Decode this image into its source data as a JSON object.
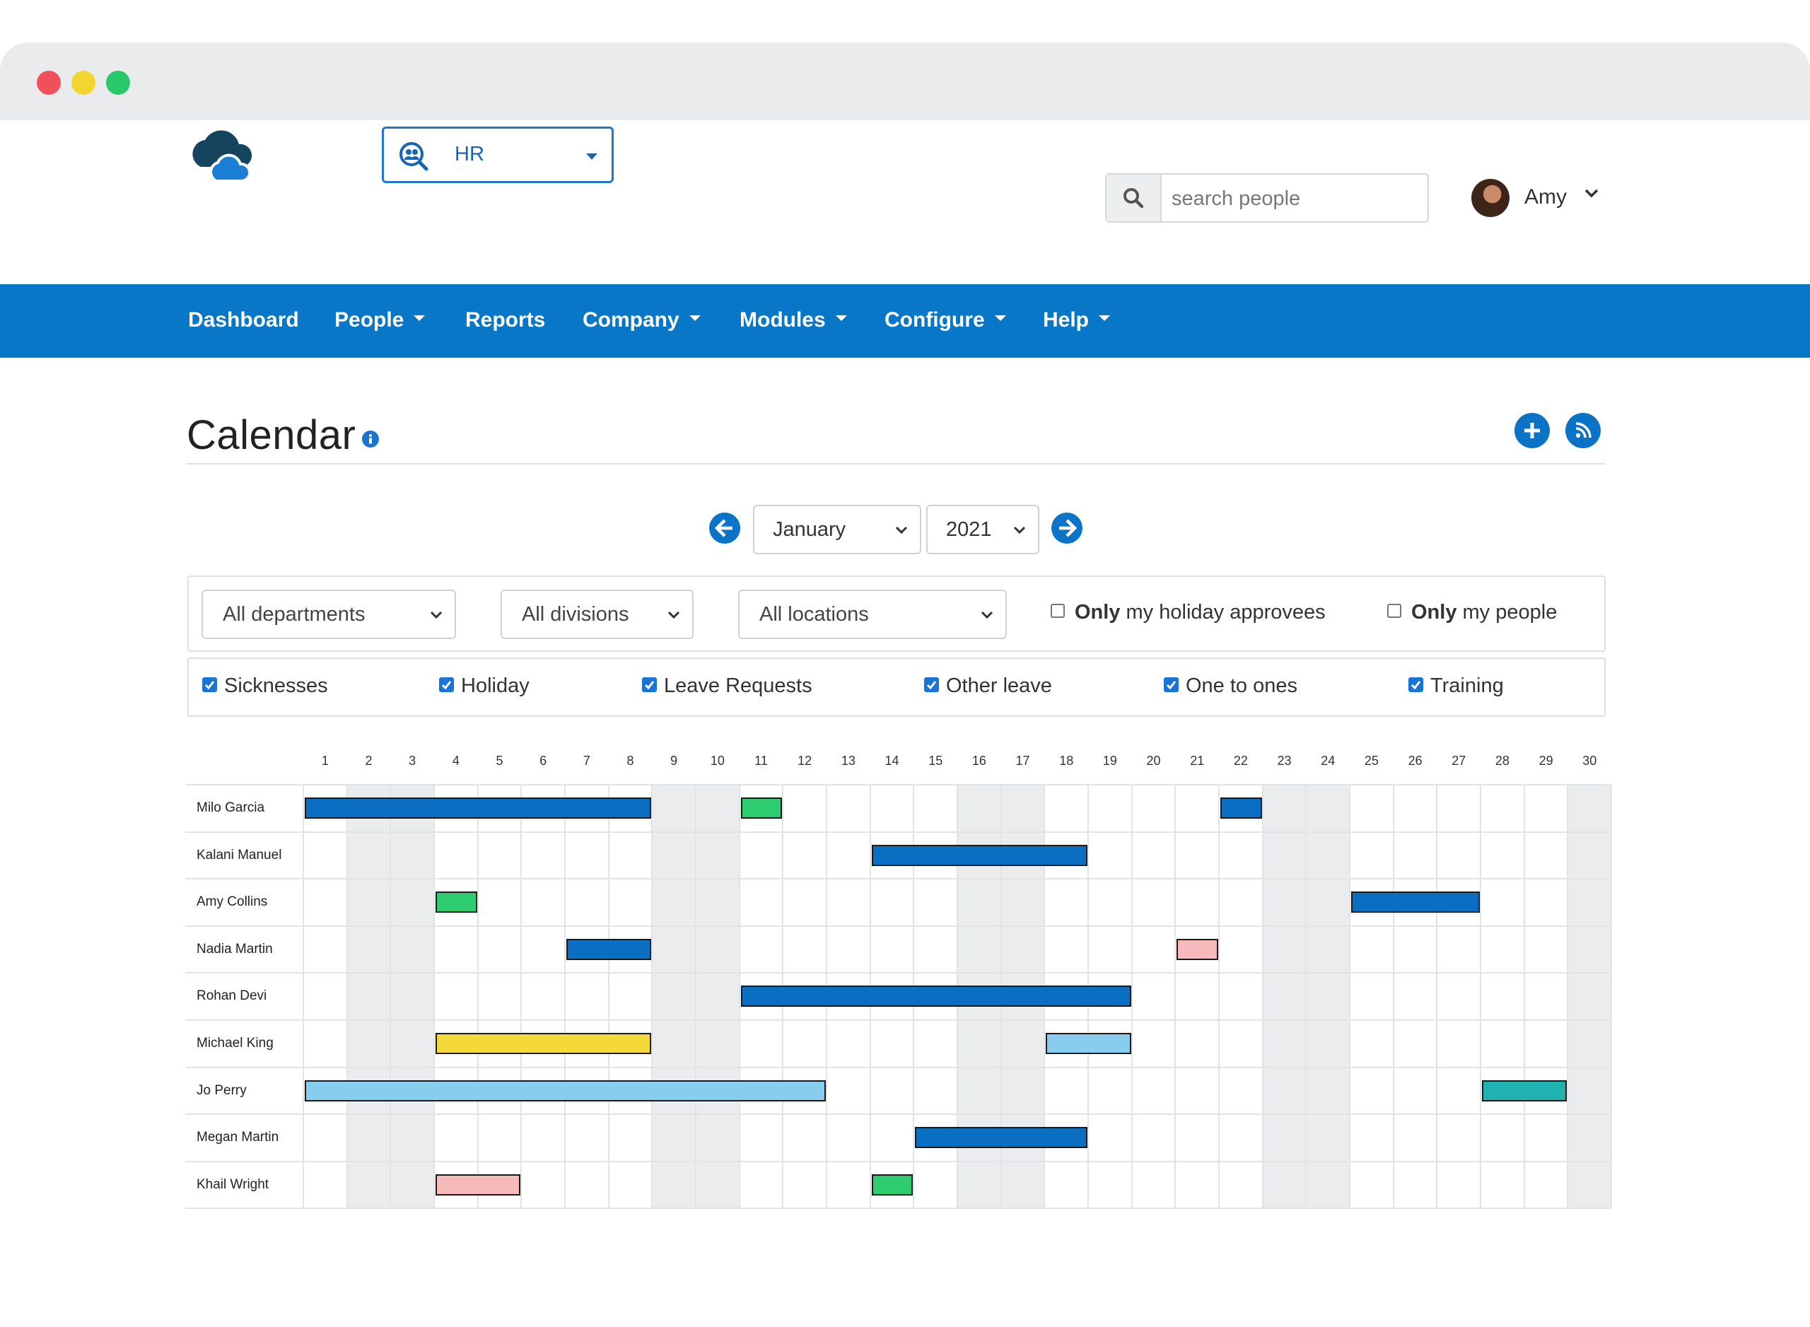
{
  "window": {
    "controls": [
      "close",
      "minimize",
      "maximize"
    ]
  },
  "header": {
    "logo_icon": "cloud-logo",
    "module_select": {
      "label": "HR",
      "icon": "people-search-icon"
    },
    "search": {
      "placeholder": "search people",
      "value": ""
    },
    "user": {
      "name": "Amy"
    }
  },
  "nav": {
    "items": [
      {
        "label": "Dashboard",
        "dropdown": false
      },
      {
        "label": "People",
        "dropdown": true
      },
      {
        "label": "Reports",
        "dropdown": false
      },
      {
        "label": "Company",
        "dropdown": true
      },
      {
        "label": "Modules",
        "dropdown": true
      },
      {
        "label": "Configure",
        "dropdown": true
      },
      {
        "label": "Help",
        "dropdown": true
      }
    ]
  },
  "page": {
    "title": "Calendar",
    "actions": [
      "add-icon",
      "rss-icon"
    ]
  },
  "period": {
    "month": "January",
    "year": "2021"
  },
  "filters": {
    "department": "All departments",
    "division": "All divisions",
    "location": "All locations",
    "only_approvees": {
      "bold": "Only",
      "rest": " my holiday approvees",
      "checked": false
    },
    "only_people": {
      "bold": "Only",
      "rest": " my people",
      "checked": false
    }
  },
  "types": [
    {
      "label": "Sicknesses",
      "checked": true
    },
    {
      "label": "Holiday",
      "checked": true
    },
    {
      "label": "Leave Requests",
      "checked": true
    },
    {
      "label": "Other leave",
      "checked": true
    },
    {
      "label": "One to ones",
      "checked": true
    },
    {
      "label": "Training",
      "checked": true
    }
  ],
  "calendar": {
    "days": [
      "1",
      "2",
      "3",
      "4",
      "5",
      "6",
      "7",
      "8",
      "9",
      "10",
      "11",
      "12",
      "13",
      "14",
      "15",
      "16",
      "17",
      "18",
      "19",
      "20",
      "21",
      "22",
      "23",
      "24",
      "25",
      "26",
      "27",
      "28",
      "29",
      "30"
    ],
    "weekend_days": [
      2,
      3,
      9,
      10,
      16,
      17,
      23,
      24,
      30
    ],
    "colors": {
      "holiday": "#0a6fc2",
      "green": "#2ecc71",
      "pink": "#f7b9b9",
      "yellow": "#f4d93a",
      "lightblue": "#87ceee",
      "teal": "#20b1b1"
    },
    "people": [
      {
        "name": "Milo Garcia",
        "events": [
          {
            "start": 1,
            "end": 8,
            "color": "holiday"
          },
          {
            "start": 11,
            "end": 11,
            "color": "green"
          },
          {
            "start": 22,
            "end": 22,
            "color": "holiday"
          }
        ]
      },
      {
        "name": "Kalani Manuel",
        "events": [
          {
            "start": 14,
            "end": 18,
            "color": "holiday"
          }
        ]
      },
      {
        "name": "Amy Collins",
        "events": [
          {
            "start": 4,
            "end": 4,
            "color": "green"
          },
          {
            "start": 25,
            "end": 27,
            "color": "holiday"
          }
        ]
      },
      {
        "name": "Nadia Martin",
        "events": [
          {
            "start": 7,
            "end": 8,
            "color": "holiday"
          },
          {
            "start": 21,
            "end": 21,
            "color": "pink"
          }
        ]
      },
      {
        "name": "Rohan Devi",
        "events": [
          {
            "start": 11,
            "end": 19,
            "color": "holiday"
          }
        ]
      },
      {
        "name": "Michael King",
        "events": [
          {
            "start": 4,
            "end": 8,
            "color": "yellow"
          },
          {
            "start": 18,
            "end": 19,
            "color": "lightblue"
          }
        ]
      },
      {
        "name": "Jo Perry",
        "events": [
          {
            "start": 1,
            "end": 12,
            "color": "lightblue"
          },
          {
            "start": 28,
            "end": 29,
            "color": "teal"
          }
        ]
      },
      {
        "name": "Megan Martin",
        "events": [
          {
            "start": 15,
            "end": 18,
            "color": "holiday"
          }
        ]
      },
      {
        "name": "Khail Wright",
        "events": [
          {
            "start": 4,
            "end": 5,
            "color": "pink"
          },
          {
            "start": 14,
            "end": 14,
            "color": "green"
          }
        ]
      }
    ]
  }
}
